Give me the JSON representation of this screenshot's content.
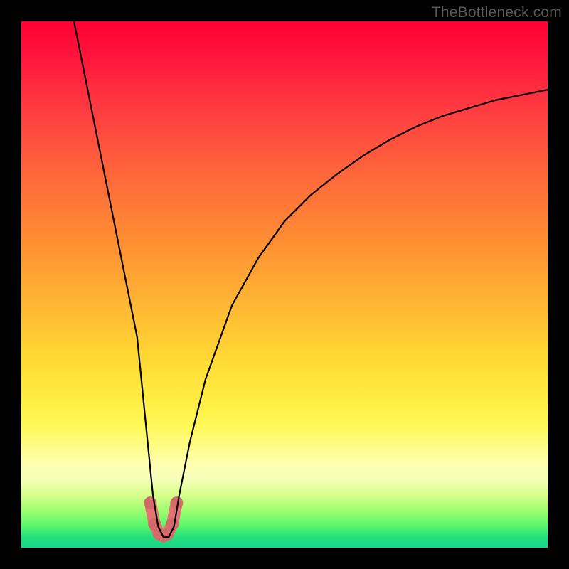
{
  "watermark": "TheBottleneck.com",
  "chart_data": {
    "type": "line",
    "title": "",
    "xlabel": "",
    "ylabel": "",
    "xlim": [
      0,
      100
    ],
    "ylim": [
      0,
      100
    ],
    "curve": {
      "x": [
        10,
        12,
        14,
        16,
        18,
        20,
        22,
        24,
        25,
        26,
        27,
        28,
        29,
        30,
        32,
        35,
        40,
        45,
        50,
        55,
        60,
        65,
        70,
        75,
        80,
        85,
        90,
        95,
        100
      ],
      "y": [
        100,
        90,
        80,
        70,
        60,
        50,
        40,
        20,
        10,
        4,
        2,
        2,
        4,
        10,
        20,
        32,
        46,
        55,
        62,
        67,
        71,
        74.5,
        77.5,
        80,
        82,
        83.5,
        85,
        86,
        87
      ]
    },
    "highlight_band": {
      "x": [
        24.5,
        25.3,
        26.2,
        27.0,
        27.8,
        28.7,
        29.5
      ],
      "y": [
        8.5,
        4.5,
        2.6,
        2.2,
        2.6,
        4.5,
        8.5
      ]
    },
    "colors": {
      "curve": "#000000",
      "highlight": "#e57373",
      "highlight_dot": "#d46a6a"
    }
  }
}
